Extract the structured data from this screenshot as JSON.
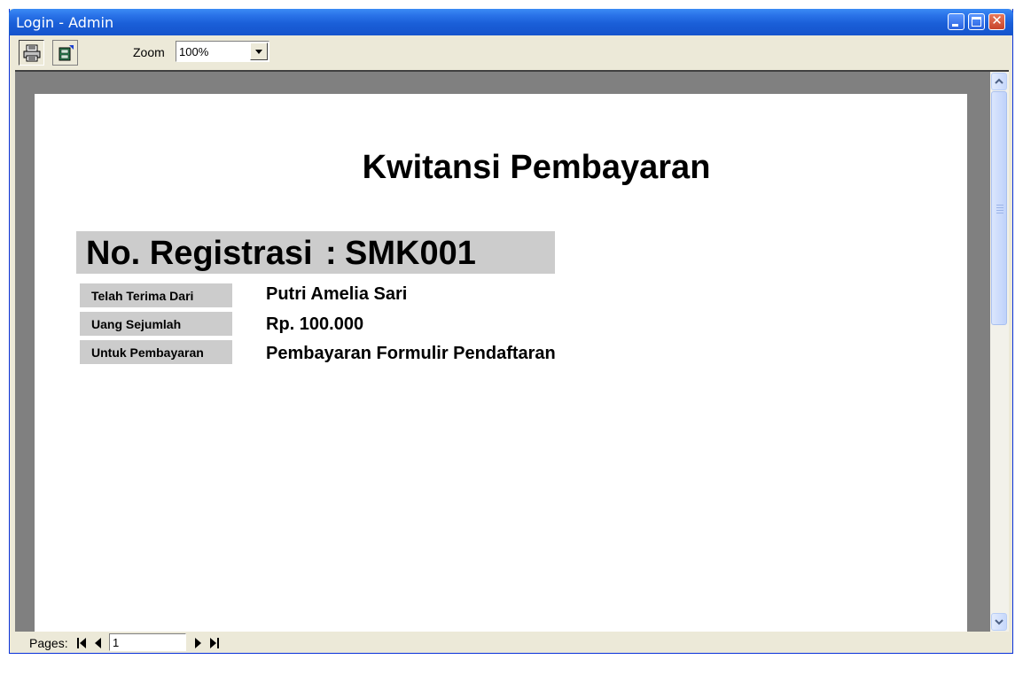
{
  "window": {
    "title": "Login - Admin"
  },
  "toolbar": {
    "zoom_label": "Zoom",
    "zoom_value": "100%",
    "print_icon": "printer-icon",
    "export_icon": "export-icon"
  },
  "report": {
    "title": "Kwitansi Pembayaran",
    "registration_label": "No. Registrasi",
    "registration_colon": ":",
    "registration_value": "SMK001",
    "fields": [
      {
        "label": "Telah Terima Dari",
        "value": "Putri Amelia Sari"
      },
      {
        "label": "Uang Sejumlah",
        "value": "Rp. 100.000"
      },
      {
        "label": "Untuk Pembayaran",
        "value": "Pembayaran Formulir Pendaftaran"
      }
    ]
  },
  "statusbar": {
    "pages_label": "Pages:",
    "current_page": "1"
  },
  "colors": {
    "titlebar": "#1a5fd8",
    "viewer_background": "#808080",
    "label_background": "#cccccc"
  }
}
